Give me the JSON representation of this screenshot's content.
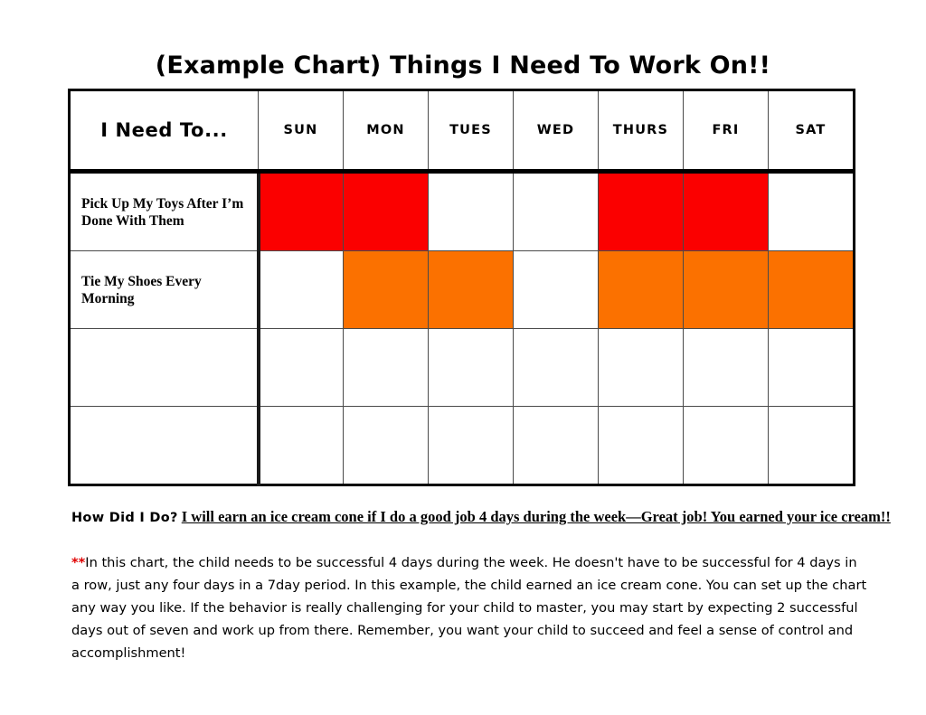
{
  "title": "(Example Chart) Things I Need To Work On!!",
  "table": {
    "task_header": "I Need To...",
    "days": [
      "SUN",
      "MON",
      "TUES",
      "WED",
      "THURS",
      "FRI",
      "SAT"
    ],
    "colors": {
      "red": "#FB0000",
      "orange": "#FB7100",
      "header_bg": "#E9E9E9",
      "empty": "#FFFFFF"
    },
    "rows": [
      {
        "task": "Pick Up My Toys After I’m Done With Them",
        "color": "red",
        "marks": [
          true,
          true,
          false,
          false,
          true,
          true,
          false
        ]
      },
      {
        "task": "Tie My Shoes Every Morning",
        "color": "orange",
        "marks": [
          false,
          true,
          true,
          false,
          true,
          true,
          true
        ]
      },
      {
        "task": "",
        "color": "none",
        "marks": [
          false,
          false,
          false,
          false,
          false,
          false,
          false
        ]
      },
      {
        "task": "",
        "color": "none",
        "marks": [
          false,
          false,
          false,
          false,
          false,
          false,
          false
        ]
      }
    ]
  },
  "how_did_i_do": {
    "label": "How Did I Do?",
    "reward": "I will earn an ice cream cone if I do a good job 4 days during the week—Great job!  You earned your ice cream!!"
  },
  "footnote": {
    "stars": "**",
    "text": "In this chart, the child needs to be successful 4 days during the week.  He doesn't have to be successful for 4 days in a row, just any four days in a 7day period.  In this example, the child earned an ice cream cone.  You can set up the chart any way you like.  If the behavior is really challenging for your child to master, you may start by expecting 2 successful days out of seven and work up from there.  Remember, you want your child to succeed and feel a sense of control and accomplishment!"
  }
}
